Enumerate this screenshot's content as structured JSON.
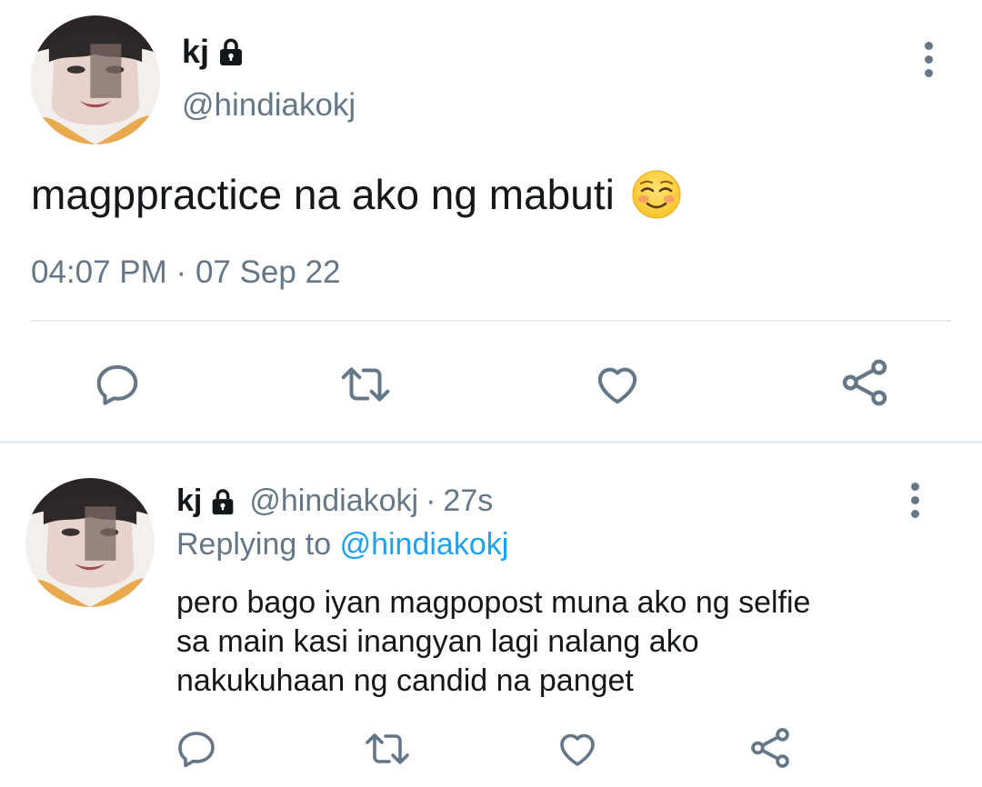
{
  "main_tweet": {
    "display_name": "kj",
    "handle": "@hindiakokj",
    "text": "magppractice na ako ng mabuti",
    "time": "04:07 PM",
    "separator": "·",
    "date": "07 Sep 22",
    "icons": {
      "protected": "lock-icon",
      "more": "more-vertical-icon",
      "emoji": "smiling-face-emoji",
      "reply": "reply-icon",
      "retweet": "retweet-icon",
      "like": "heart-icon",
      "share": "share-icon"
    }
  },
  "reply_tweet": {
    "display_name": "kj",
    "handle": "@hindiakokj",
    "separator": "·",
    "age": "27s",
    "replying_label": "Replying to",
    "replying_handle": "@hindiakokj",
    "text_lines": [
      "pero bago iyan magpopost muna ako ng selfie",
      "sa main kasi inangyan lagi nalang ako",
      "nakukuhaan ng candid na panget"
    ]
  },
  "colors": {
    "text_primary": "#14171a",
    "text_secondary": "#657786",
    "link": "#1da1f2",
    "divider": "#e6ecf0"
  }
}
